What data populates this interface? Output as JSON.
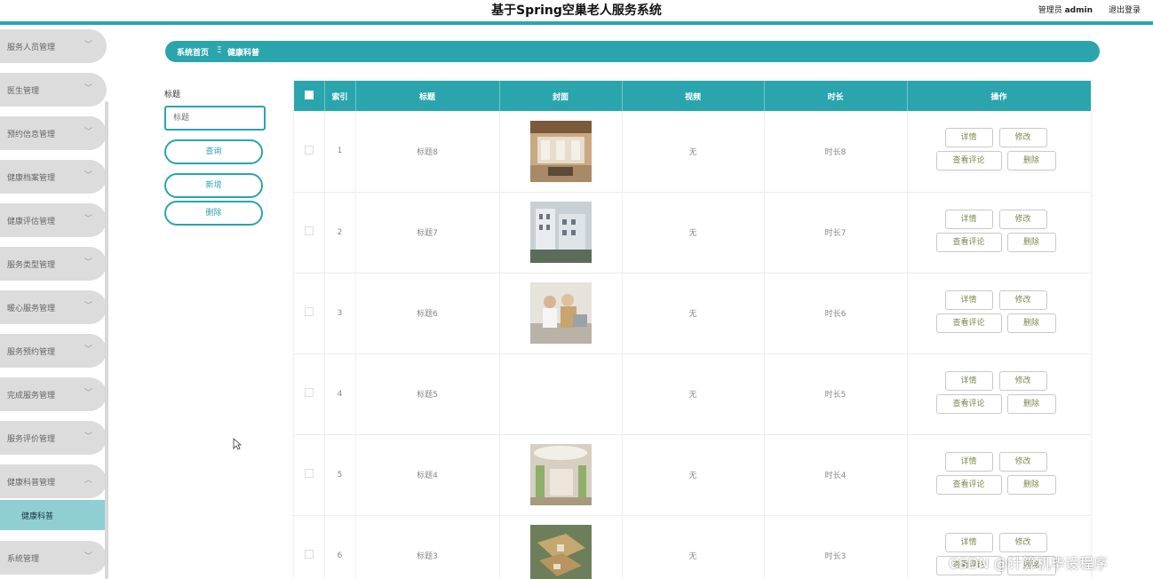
{
  "header": {
    "title": "基于Spring空巢老人服务系统",
    "user_prefix": "管理员",
    "username": "admin",
    "logout": "退出登录",
    "accent": "#2aa5ad"
  },
  "sidebar": {
    "items": [
      {
        "label": "服务人员管理"
      },
      {
        "label": "医生管理"
      },
      {
        "label": "预约信息管理"
      },
      {
        "label": "健康档案管理"
      },
      {
        "label": "健康评估管理"
      },
      {
        "label": "服务类型管理"
      },
      {
        "label": "暖心服务管理"
      },
      {
        "label": "服务预约管理"
      },
      {
        "label": "完成服务管理"
      },
      {
        "label": "服务评价管理"
      },
      {
        "label": "健康科普管理"
      },
      {
        "label": "系统管理"
      }
    ],
    "submenu": {
      "label": "健康科普"
    }
  },
  "breadcrumb": {
    "home": "系统首页",
    "separator": "Ξ",
    "current": "健康科普"
  },
  "filter": {
    "label": "标题",
    "placeholder": "标题",
    "search": "查询",
    "add": "新增",
    "delete": "删除"
  },
  "table": {
    "columns": [
      "索引",
      "标题",
      "封面",
      "视频",
      "时长",
      "操作"
    ],
    "ops": {
      "detail": "详情",
      "edit": "修改",
      "comments": "查看评论",
      "delete": "删除"
    },
    "rows": [
      {
        "index": "1",
        "title": "标题8",
        "video": "无",
        "duration": "时长8",
        "cover": "lobby"
      },
      {
        "index": "2",
        "title": "标题7",
        "video": "无",
        "duration": "时长7",
        "cover": "building"
      },
      {
        "index": "3",
        "title": "标题6",
        "video": "无",
        "duration": "时长6",
        "cover": "care"
      },
      {
        "index": "4",
        "title": "标题5",
        "video": "无",
        "duration": "时长5",
        "cover": ""
      },
      {
        "index": "5",
        "title": "标题4",
        "video": "无",
        "duration": "时长4",
        "cover": "hall"
      },
      {
        "index": "6",
        "title": "标题3",
        "video": "无",
        "duration": "时长3",
        "cover": "aerial"
      }
    ]
  },
  "watermark": "CSDN @计算机毕设程序"
}
